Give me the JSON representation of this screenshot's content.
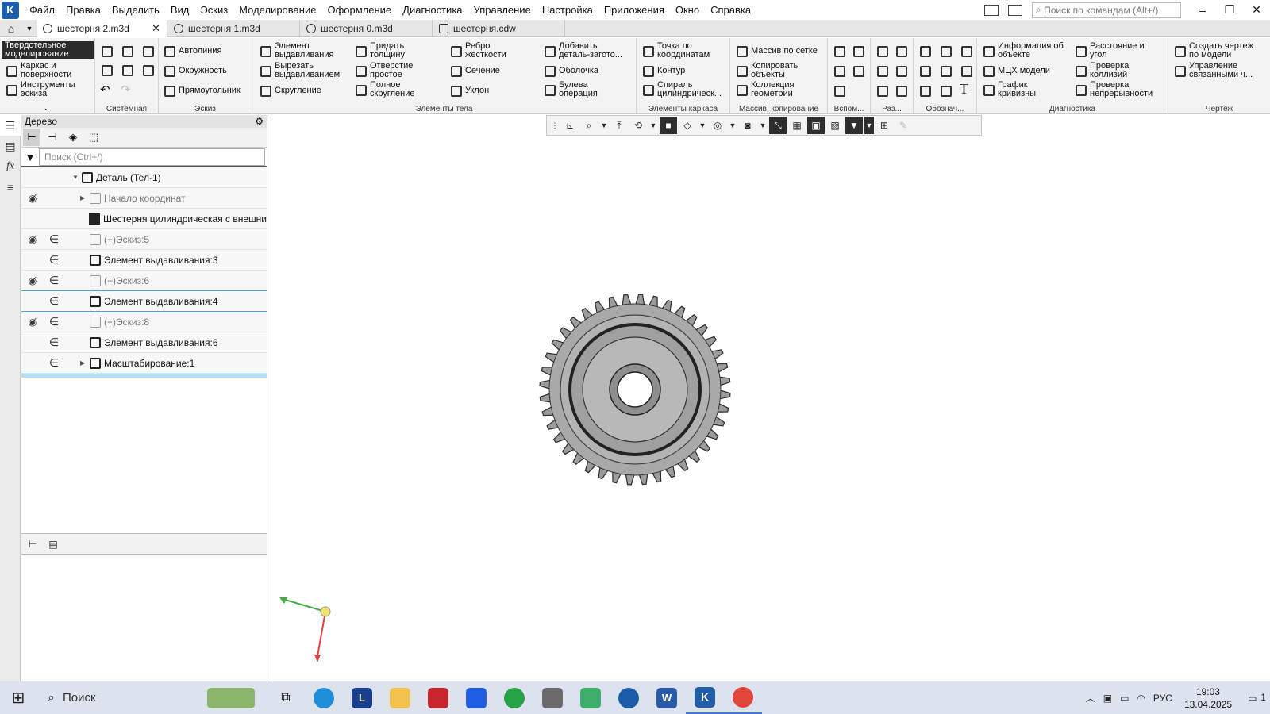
{
  "menu": {
    "items": [
      "Файл",
      "Правка",
      "Выделить",
      "Вид",
      "Эскиз",
      "Моделирование",
      "Оформление",
      "Диагностика",
      "Управление",
      "Настройка",
      "Приложения",
      "Окно",
      "Справка"
    ],
    "search_placeholder": "Поиск по командам (Alt+/)"
  },
  "tabs": [
    {
      "label": "шестерня 2.m3d"
    },
    {
      "label": "шестерня 1.m3d"
    },
    {
      "label": "шестерня 0.m3d"
    },
    {
      "label": "шестерня.cdw"
    }
  ],
  "ribbon": {
    "modes": [
      "Твердотельное\nмоделирование",
      "Каркас и\nповерхности",
      "Инструменты\nэскиза"
    ],
    "groups": {
      "system": "Системная",
      "sketch": "Эскиз",
      "body": "Элементы тела",
      "frame": "Элементы каркаса",
      "array": "Массив, копирование",
      "aux": "Вспом...",
      "size": "Раз...",
      "notation": "Обознач...",
      "diag": "Диагностика",
      "drawing": "Чертеж"
    },
    "sketch_items": [
      "Автолиния",
      "Окружность",
      "Прямоугольник"
    ],
    "body_items": [
      "Элемент\nвыдавливания",
      "Вырезать\nвыдавливанием",
      "Скругление",
      "Придать\nтолщину",
      "Отверстие\nпростое",
      "Полное\nскругление",
      "Ребро\nжесткости",
      "Сечение",
      "Уклон",
      "Добавить\nдеталь-загото...",
      "Оболочка",
      "Булева\nоперация"
    ],
    "frame_items": [
      "Точка по\nкоординатам",
      "Контур",
      "Спираль\nцилиндрическ..."
    ],
    "array_items": [
      "Массив по сетке",
      "Копировать\nобъекты",
      "Коллекция\nгеометрии"
    ],
    "diag_items": [
      "Информация об\nобъекте",
      "МЦХ модели",
      "График\nкривизны",
      "Расстояние и\nугол",
      "Проверка\nколлизий",
      "Проверка\nнепрерывности"
    ],
    "drawing_items": [
      "Создать чертеж\nпо модели",
      "Управление\nсвязанными ч..."
    ]
  },
  "tree": {
    "title": "Дерево",
    "search_placeholder": "Поиск (Ctrl+/)",
    "rows": [
      {
        "label": "Деталь (Тел-1)"
      },
      {
        "label": "Начало координат"
      },
      {
        "label": "Шестерня цилиндрическая с внешни"
      },
      {
        "label": "(+)Эскиз:5"
      },
      {
        "label": "Элемент выдавливания:3"
      },
      {
        "label": "(+)Эскиз:6"
      },
      {
        "label": "Элемент выдавливания:4"
      },
      {
        "label": "(+)Эскиз:8"
      },
      {
        "label": "Элемент выдавливания:6"
      },
      {
        "label": "Масштабирование:1"
      }
    ]
  },
  "taskbar": {
    "search_label": "Поиск",
    "language": "РУС",
    "time": "19:03",
    "date": "13.04.2025",
    "notifications": "1"
  },
  "colors": {
    "accent": "#1f5fa8",
    "gear": "#a9a9a9",
    "selection": "#4aa8d8"
  }
}
